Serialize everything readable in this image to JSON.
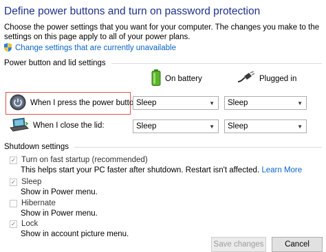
{
  "page": {
    "title": "Define power buttons and turn on password protection",
    "description": "Choose the power settings that you want for your computer. The changes you make to the settings on this page apply to all of your power plans.",
    "change_link": "Change settings that are currently unavailable"
  },
  "power_button_section": {
    "header": "Power button and lid settings",
    "columns": {
      "on_battery": "On battery",
      "plugged_in": "Plugged in"
    },
    "rows": [
      {
        "label": "When I press the power button:",
        "on_battery": "Sleep",
        "plugged_in": "Sleep"
      },
      {
        "label": "When I close the lid:",
        "on_battery": "Sleep",
        "plugged_in": "Sleep"
      }
    ]
  },
  "shutdown_section": {
    "header": "Shutdown settings",
    "items": [
      {
        "label": "Turn on fast startup (recommended)",
        "checked": true,
        "description": "This helps start your PC faster after shutdown. Restart isn't affected.",
        "link": "Learn More"
      },
      {
        "label": "Sleep",
        "checked": true,
        "description": "Show in Power menu."
      },
      {
        "label": "Hibernate",
        "checked": false,
        "description": "Show in Power menu."
      },
      {
        "label": "Lock",
        "checked": true,
        "description": "Show in account picture menu."
      }
    ]
  },
  "buttons": {
    "save": "Save changes",
    "cancel": "Cancel"
  },
  "icons": {
    "shield": "shield-icon",
    "battery": "battery-icon",
    "plug": "plug-icon",
    "power": "power-button-icon",
    "lid": "laptop-lid-icon",
    "check": "✓"
  },
  "colors": {
    "title": "#1e3287",
    "link": "#0a64c8",
    "highlight": "#d9534f"
  }
}
